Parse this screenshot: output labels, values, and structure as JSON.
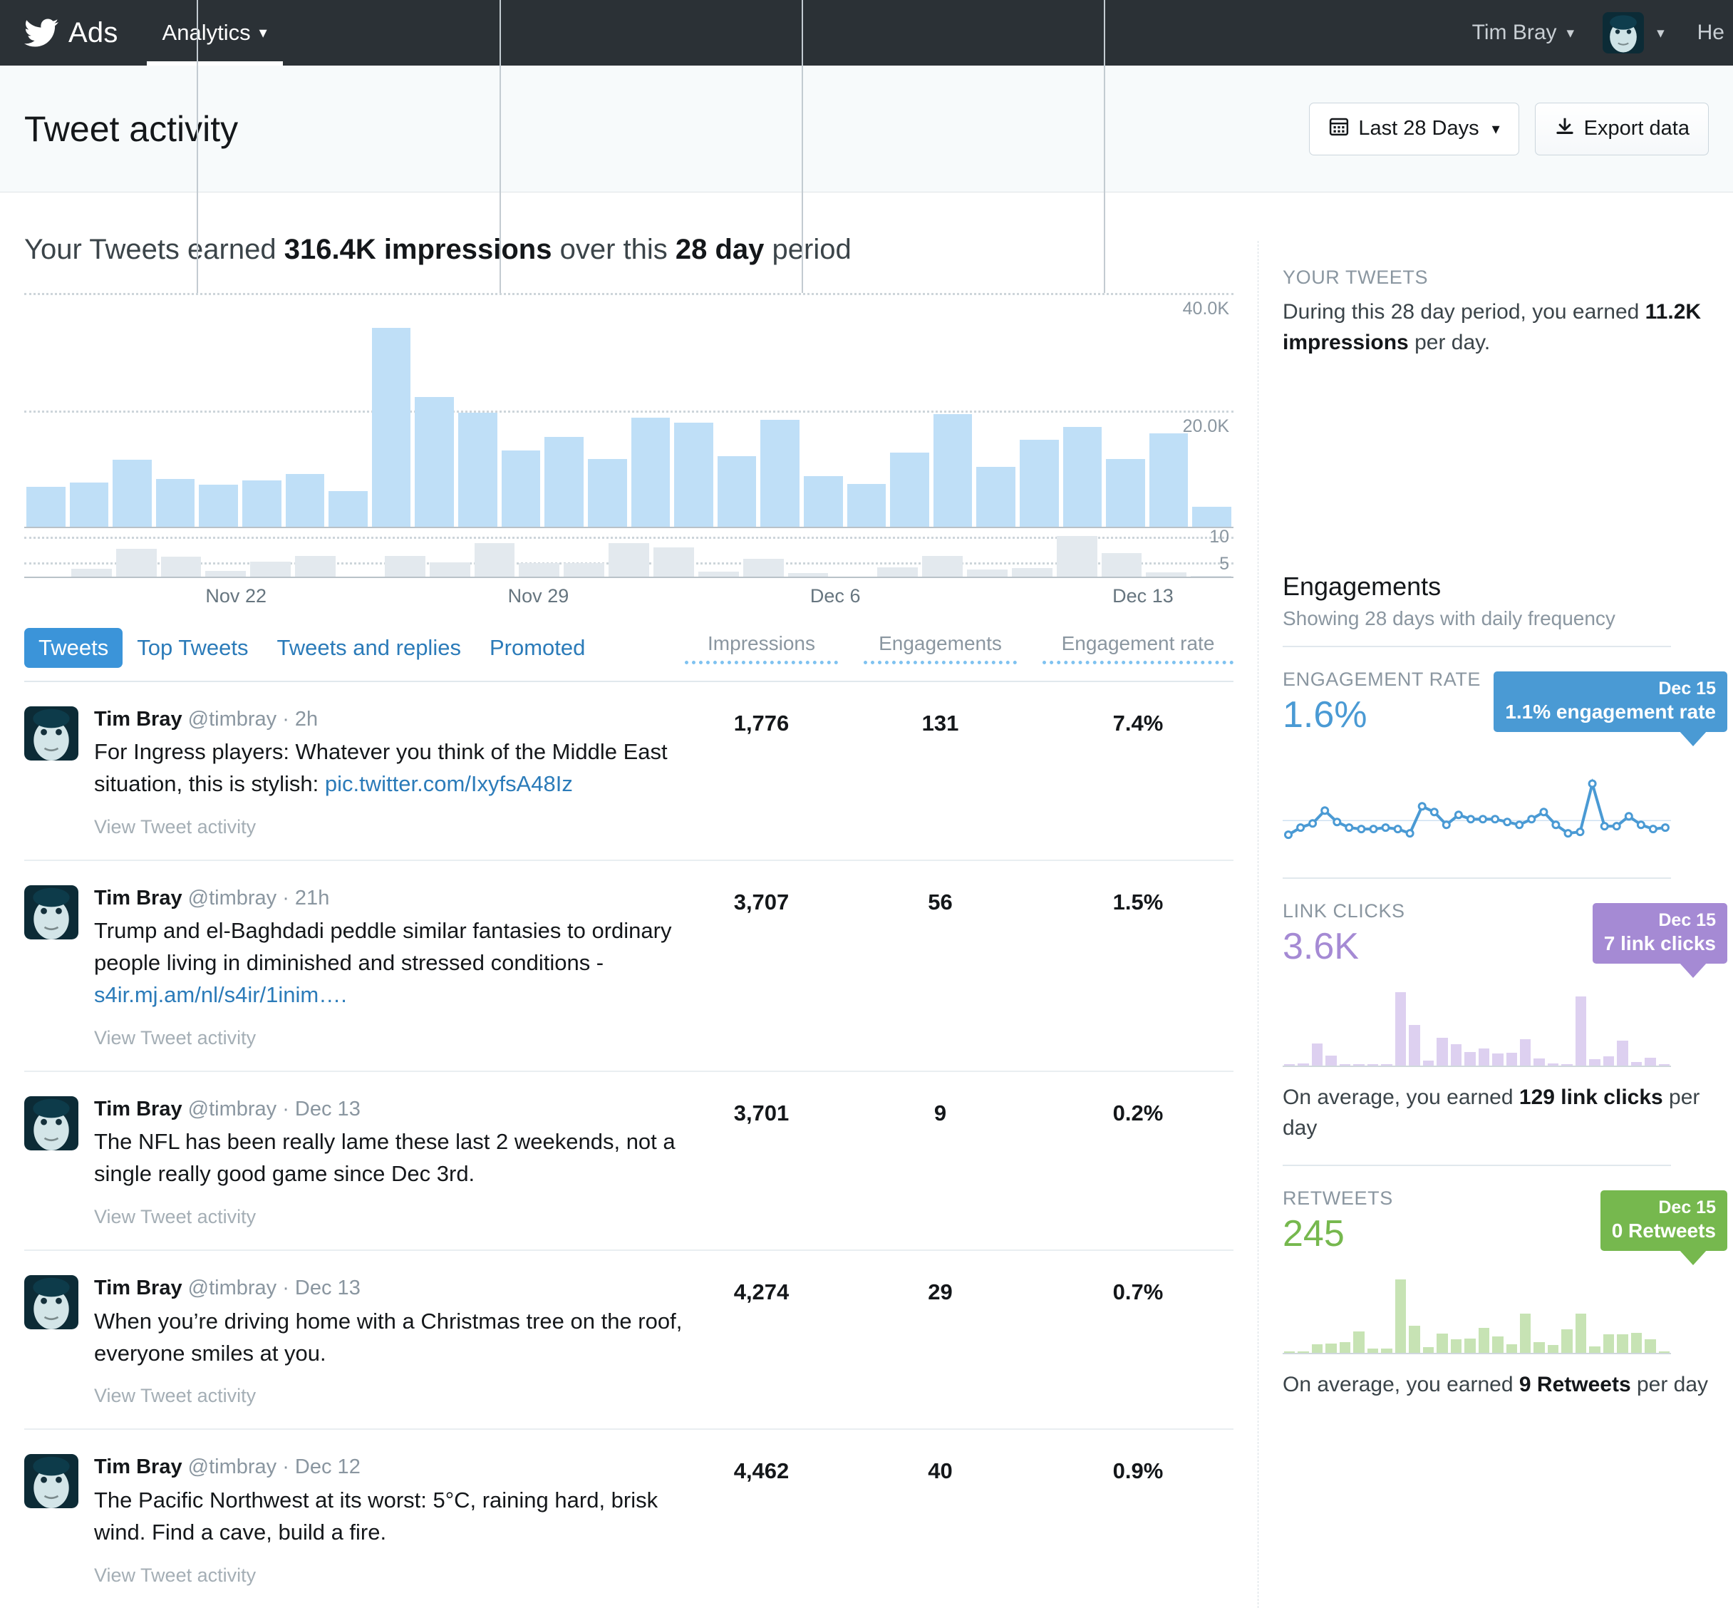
{
  "nav": {
    "brand": "Ads",
    "tab_analytics": "Analytics",
    "caret": "⌄",
    "user_name": "Tim Bray",
    "help": "He"
  },
  "header": {
    "title": "Tweet activity",
    "date_range_button": "Last 28 Days",
    "export_button": "Export data",
    "calendar_icon": "calendar-icon",
    "download_icon": "download-icon"
  },
  "summary": {
    "prefix": "Your Tweets earned ",
    "impressions": "316.4K impressions",
    "middle": " over this ",
    "period": "28 day",
    "suffix": " period"
  },
  "your_tweets": {
    "kicker": "YOUR TWEETS",
    "line1": "During this 28 day period, you earned ",
    "highlight": "11.2K impressions",
    "line2": " per day."
  },
  "tabs": [
    {
      "label": "Tweets",
      "active": true
    },
    {
      "label": "Top Tweets",
      "active": false
    },
    {
      "label": "Tweets and replies",
      "active": false
    },
    {
      "label": "Promoted",
      "active": false
    }
  ],
  "columns": {
    "impressions": "Impressions",
    "engagements": "Engagements",
    "engagement_rate": "Engagement rate"
  },
  "tweets": [
    {
      "name": "Tim Bray",
      "handle": "@timbray",
      "time": "2h",
      "text": "For Ingress players: Whatever you think of the Middle East situation, this is stylish: ",
      "link": "pic.twitter.com/IxyfsA48Iz",
      "view": "View Tweet activity",
      "impressions": "1,776",
      "engagements": "131",
      "rate": "7.4%"
    },
    {
      "name": "Tim Bray",
      "handle": "@timbray",
      "time": "21h",
      "text": "Trump and el-Baghdadi peddle similar fantasies to ordinary people living in diminished and stressed conditions - ",
      "link": "s4ir.mj.am/nl/s4ir/1inim….",
      "view": "View Tweet activity",
      "impressions": "3,707",
      "engagements": "56",
      "rate": "1.5%"
    },
    {
      "name": "Tim Bray",
      "handle": "@timbray",
      "time": "Dec 13",
      "text": "The NFL has been really lame these last 2 weekends, not a single really good game since Dec 3rd.",
      "link": "",
      "view": "View Tweet activity",
      "impressions": "3,701",
      "engagements": "9",
      "rate": "0.2%"
    },
    {
      "name": "Tim Bray",
      "handle": "@timbray",
      "time": "Dec 13",
      "text": "When you’re driving home with a Christmas tree on the roof, everyone smiles at you.",
      "link": "",
      "view": "View Tweet activity",
      "impressions": "4,274",
      "engagements": "29",
      "rate": "0.7%"
    },
    {
      "name": "Tim Bray",
      "handle": "@timbray",
      "time": "Dec 12",
      "text": "The Pacific Northwest at its worst: 5°C, raining hard, brisk wind.  Find a cave, build a fire.",
      "link": "",
      "view": "View Tweet activity",
      "impressions": "4,462",
      "engagements": "40",
      "rate": "0.9%"
    }
  ],
  "engagements_panel": {
    "title": "Engagements",
    "subtitle": "Showing 28 days with daily frequency",
    "engagement_rate": {
      "kicker": "ENGAGEMENT RATE",
      "value": "1.6%",
      "tooltip_date": "Dec 15",
      "tooltip_value": "1.1% engagement rate"
    },
    "link_clicks": {
      "kicker": "LINK CLICKS",
      "value": "3.6K",
      "tooltip_date": "Dec 15",
      "tooltip_value": "7 link clicks",
      "note_prefix": "On average, you earned ",
      "note_highlight": "129 link clicks",
      "note_suffix": " per day"
    },
    "retweets": {
      "kicker": "RETWEETS",
      "value": "245",
      "tooltip_date": "Dec 15",
      "tooltip_value": "0 Retweets",
      "note_prefix": "On average, you earned ",
      "note_highlight": "9 Retweets",
      "note_suffix": " per day"
    }
  },
  "colors": {
    "brand_blue": "#3b94d9",
    "impression_bar": "#bfdff7",
    "engagement_bar": "#e3e9ee",
    "link_clicks": "#a58ad4",
    "retweets": "#76b84e",
    "nav_bg": "#2b3136"
  },
  "chart_data": {
    "type": "bar",
    "title": "Impressions and engagements by day",
    "xlabel": "",
    "ylabel": "Impressions",
    "grid": true,
    "ylim": [
      0,
      44000
    ],
    "ylim_lower": [
      0,
      12
    ],
    "ytick_labels": [
      "40.0K",
      "20.0K"
    ],
    "ytick_values": [
      40000,
      20000
    ],
    "ytick_labels_lower": [
      "10",
      "5"
    ],
    "ytick_values_lower": [
      10,
      5
    ],
    "x_tick_labels": [
      "Nov 22",
      "Nov 29",
      "Dec 6",
      "Dec 13"
    ],
    "x_tick_indices": [
      4,
      11,
      18,
      25
    ],
    "categories": [
      "Nov 18",
      "Nov 19",
      "Nov 20",
      "Nov 21",
      "Nov 22",
      "Nov 23",
      "Nov 24",
      "Nov 25",
      "Nov 26",
      "Nov 27",
      "Nov 28",
      "Nov 29",
      "Nov 30",
      "Dec 1",
      "Dec 2",
      "Dec 3",
      "Dec 4",
      "Dec 5",
      "Dec 6",
      "Dec 7",
      "Dec 8",
      "Dec 9",
      "Dec 10",
      "Dec 11",
      "Dec 12",
      "Dec 13",
      "Dec 14",
      "Dec 15"
    ],
    "series": [
      {
        "name": "Impressions",
        "values": [
          7800,
          8600,
          12800,
          9200,
          8200,
          9000,
          10200,
          6900,
          37500,
          24500,
          21600,
          14500,
          17100,
          12900,
          20700,
          19800,
          13500,
          20300,
          9700,
          8300,
          14200,
          21400,
          11500,
          16500,
          18900,
          13000,
          17800,
          4000
        ]
      },
      {
        "name": "Engagements",
        "values": [
          0.4,
          2.3,
          7.1,
          5.2,
          1.8,
          4.0,
          5.4,
          0.3,
          5.3,
          3.8,
          8.4,
          3.6,
          3.6,
          8.4,
          7.4,
          1.5,
          4.6,
          1.2,
          0.3,
          2.6,
          5.3,
          2.0,
          2.4,
          10.2,
          6.0,
          1.4,
          0.6
        ]
      }
    ]
  },
  "sparkline_data": {
    "type": "line",
    "name": "Engagement rate",
    "values": [
      0.6,
      1.1,
      1.4,
      2.3,
      1.5,
      1.1,
      1.0,
      1.0,
      1.1,
      1.0,
      0.7,
      2.6,
      2.2,
      1.3,
      2.0,
      1.7,
      1.7,
      1.7,
      1.5,
      1.3,
      1.7,
      2.2,
      1.3,
      0.7,
      0.8,
      4.2,
      1.2,
      1.2,
      1.9,
      1.3,
      1.0,
      1.1
    ],
    "average_line": 1.6
  },
  "link_clicks_data": {
    "type": "bar",
    "name": "Link clicks",
    "values": [
      2,
      8,
      80,
      35,
      6,
      4,
      5,
      5,
      260,
      145,
      18,
      98,
      75,
      48,
      62,
      44,
      45,
      95,
      25,
      7,
      6,
      245,
      24,
      33,
      88,
      12,
      28,
      5
    ]
  },
  "retweets_data": {
    "type": "bar",
    "name": "Retweets",
    "values": [
      2,
      2,
      9,
      10,
      11,
      22,
      5,
      5,
      75,
      28,
      6,
      20,
      14,
      15,
      26,
      17,
      9,
      40,
      11,
      8,
      24,
      40,
      7,
      19,
      19,
      21,
      14,
      2
    ]
  }
}
